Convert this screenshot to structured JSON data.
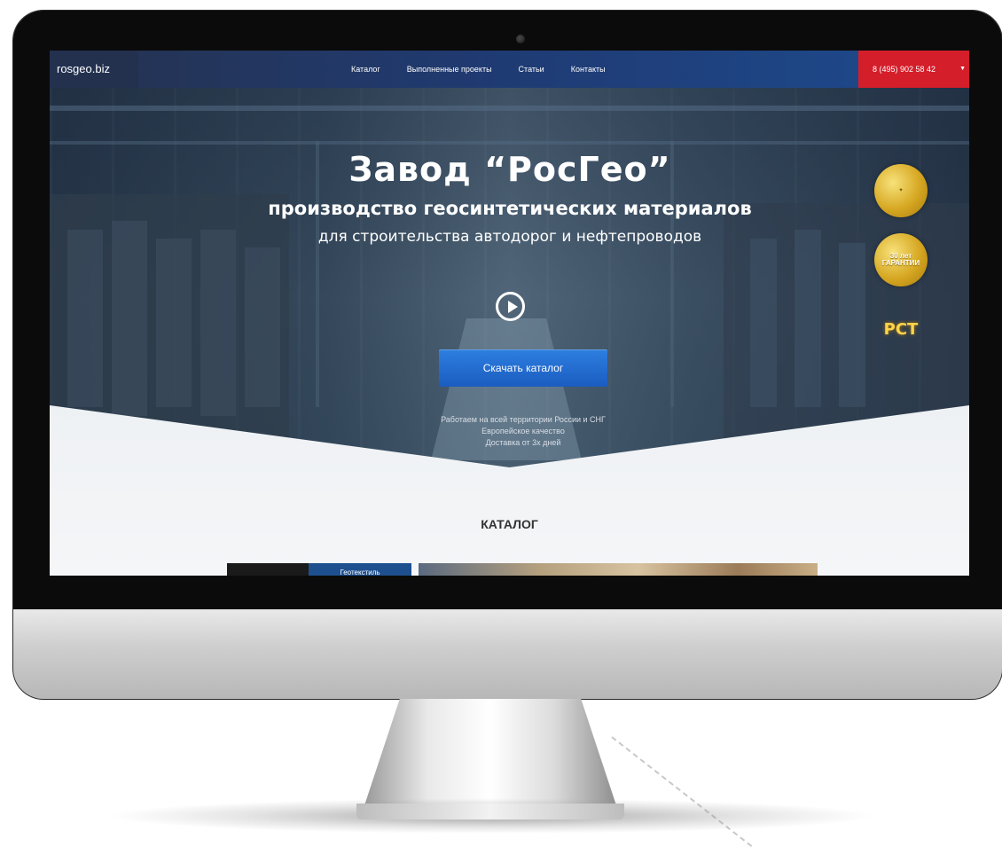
{
  "nav": {
    "logo": "rosgeo.biz",
    "links": [
      "Каталог",
      "Выполненные проекты",
      "Статьи",
      "Контакты"
    ],
    "phone": "8 (495) 902 58 42"
  },
  "hero": {
    "title": "Завод “РосГео”",
    "subtitle": "производство геосинтетических материалов",
    "tagline": "для строительства автодорог и нефтепроводов",
    "download_label": "Скачать каталог",
    "features": [
      "Работаем на всей территории России и СНГ",
      "Европейское качество",
      "Доставка от 3х дней"
    ],
    "badges": {
      "guarantee": "30 лет ГАРАНТИИ",
      "rst": "РСТ"
    }
  },
  "catalog": {
    "heading": "КАТАЛОГ",
    "first_item": "Геотекстиль"
  },
  "colors": {
    "nav": "#1f3b74",
    "phone_bg": "#d41e2a",
    "button": "#2d7fe0"
  }
}
